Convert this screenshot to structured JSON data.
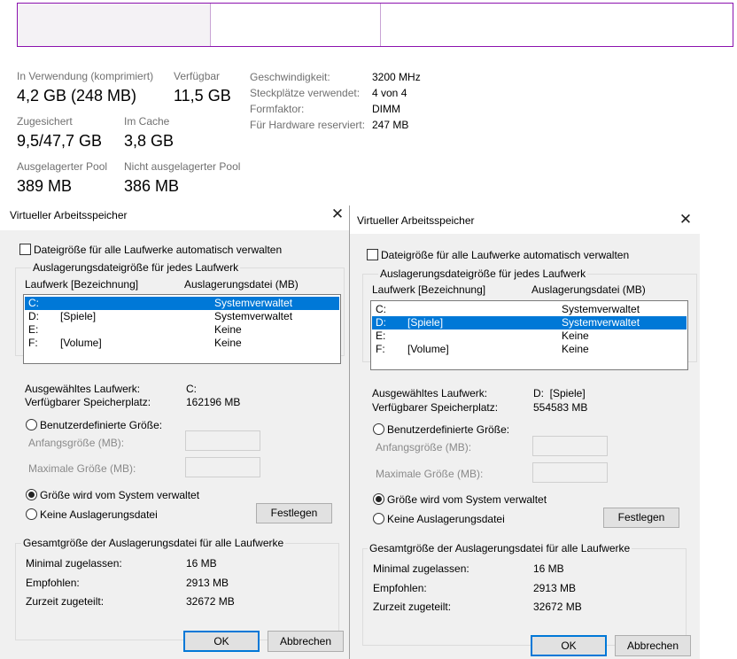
{
  "task_manager": {
    "bar_colors": {
      "border": "#8b12ae",
      "in_use": "#f4f2f5",
      "divider": "#c8a3d4"
    },
    "stats": {
      "in_use_label": "In Verwendung (komprimiert)",
      "in_use_value": "4,2 GB (248 MB)",
      "available_label": "Verfügbar",
      "available_value": "11,5 GB",
      "committed_label": "Zugesichert",
      "committed_value": "9,5/47,7 GB",
      "cached_label": "Im Cache",
      "cached_value": "3,8 GB",
      "paged_pool_label": "Ausgelagerter Pool",
      "paged_pool_value": "389 MB",
      "nonpaged_pool_label": "Nicht ausgelagerter Pool",
      "nonpaged_pool_value": "386 MB"
    },
    "specs": [
      {
        "label": "Geschwindigkeit:",
        "value": "3200 MHz"
      },
      {
        "label": "Steckplätze verwendet:",
        "value": "4 von 4"
      },
      {
        "label": "Formfaktor:",
        "value": "DIMM"
      },
      {
        "label": "Für Hardware reserviert:",
        "value": "247 MB"
      }
    ]
  },
  "dialogs": [
    {
      "title": "Virtueller Arbeitsspeicher",
      "close_glyph": "✕",
      "auto_manage_label": "Dateigröße für alle Laufwerke automatisch verwalten",
      "per_drive_group_title": "Auslagerungsdateigröße für jedes Laufwerk",
      "col_drive": "Laufwerk [Bezeichnung]",
      "col_pagefile": "Auslagerungsdatei (MB)",
      "drives": [
        {
          "letter": "C:",
          "label": "",
          "pagefile": "Systemverwaltet",
          "selected": true
        },
        {
          "letter": "D:",
          "label": "[Spiele]",
          "pagefile": "Systemverwaltet",
          "selected": false
        },
        {
          "letter": "E:",
          "label": "",
          "pagefile": "Keine",
          "selected": false
        },
        {
          "letter": "F:",
          "label": "[Volume]",
          "pagefile": "Keine",
          "selected": false
        }
      ],
      "selected_drive_label": "Ausgewähltes Laufwerk:",
      "selected_drive_value": "C:",
      "free_space_label": "Verfügbarer Speicherplatz:",
      "free_space_value": "162196 MB",
      "custom_size_label": "Benutzerdefinierte Größe:",
      "initial_size_label": "Anfangsgröße (MB):",
      "max_size_label": "Maximale Größe (MB):",
      "system_managed_label": "Größe wird vom System verwaltet",
      "no_pagefile_label": "Keine Auslagerungsdatei",
      "set_button": "Festlegen",
      "total_group_title": "Gesamtgröße der Auslagerungsdatei für alle Laufwerke",
      "min_allowed_label": "Minimal zugelassen:",
      "min_allowed_value": "16 MB",
      "recommended_label": "Empfohlen:",
      "recommended_value": "2913 MB",
      "allocated_label": "Zurzeit zugeteilt:",
      "allocated_value": "32672 MB",
      "ok_button": "OK",
      "cancel_button": "Abbrechen"
    },
    {
      "title": "Virtueller Arbeitsspeicher",
      "close_glyph": "✕",
      "auto_manage_label": "Dateigröße für alle Laufwerke automatisch verwalten",
      "per_drive_group_title": "Auslagerungsdateigröße für jedes Laufwerk",
      "col_drive": "Laufwerk [Bezeichnung]",
      "col_pagefile": "Auslagerungsdatei (MB)",
      "drives": [
        {
          "letter": "C:",
          "label": "",
          "pagefile": "Systemverwaltet",
          "selected": false
        },
        {
          "letter": "D:",
          "label": "[Spiele]",
          "pagefile": "Systemverwaltet",
          "selected": true
        },
        {
          "letter": "E:",
          "label": "",
          "pagefile": "Keine",
          "selected": false
        },
        {
          "letter": "F:",
          "label": "[Volume]",
          "pagefile": "Keine",
          "selected": false
        }
      ],
      "selected_drive_label": "Ausgewähltes Laufwerk:",
      "selected_drive_value": "D:  [Spiele]",
      "free_space_label": "Verfügbarer Speicherplatz:",
      "free_space_value": "554583 MB",
      "custom_size_label": "Benutzerdefinierte Größe:",
      "initial_size_label": "Anfangsgröße (MB):",
      "max_size_label": "Maximale Größe (MB):",
      "system_managed_label": "Größe wird vom System verwaltet",
      "no_pagefile_label": "Keine Auslagerungsdatei",
      "set_button": "Festlegen",
      "total_group_title": "Gesamtgröße der Auslagerungsdatei für alle Laufwerke",
      "min_allowed_label": "Minimal zugelassen:",
      "min_allowed_value": "16 MB",
      "recommended_label": "Empfohlen:",
      "recommended_value": "2913 MB",
      "allocated_label": "Zurzeit zugeteilt:",
      "allocated_value": "32672 MB",
      "ok_button": "OK",
      "cancel_button": "Abbrechen"
    }
  ]
}
